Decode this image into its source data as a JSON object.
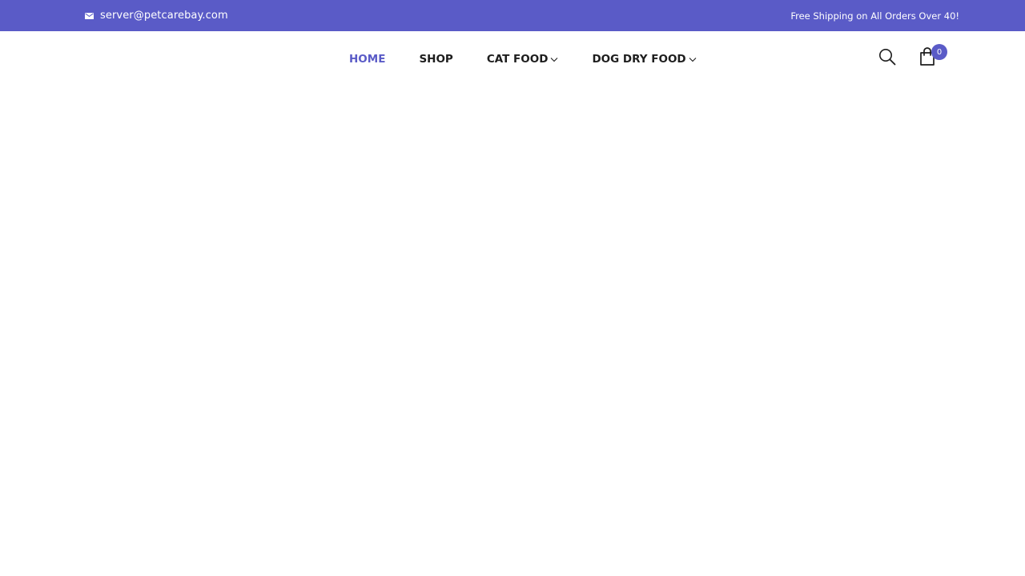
{
  "topbar": {
    "email": "server@petcarebay.com",
    "promo": "Free Shipping on All Orders Over 40!",
    "email_icon": "mail-icon",
    "background_color": "#5a5bc7"
  },
  "nav": {
    "items": [
      {
        "label": "HOME",
        "active": true,
        "has_dropdown": false
      },
      {
        "label": "SHOP",
        "active": false,
        "has_dropdown": false
      },
      {
        "label": "CAT FOOD",
        "active": false,
        "has_dropdown": true
      },
      {
        "label": "DOG DRY FOOD",
        "active": false,
        "has_dropdown": true
      }
    ],
    "active_color": "#5a5bc7",
    "text_color": "#1d1d1d"
  },
  "header_icons": {
    "search_icon": "search-icon",
    "cart_icon": "shopping-bag-icon",
    "cart_count": "0"
  }
}
